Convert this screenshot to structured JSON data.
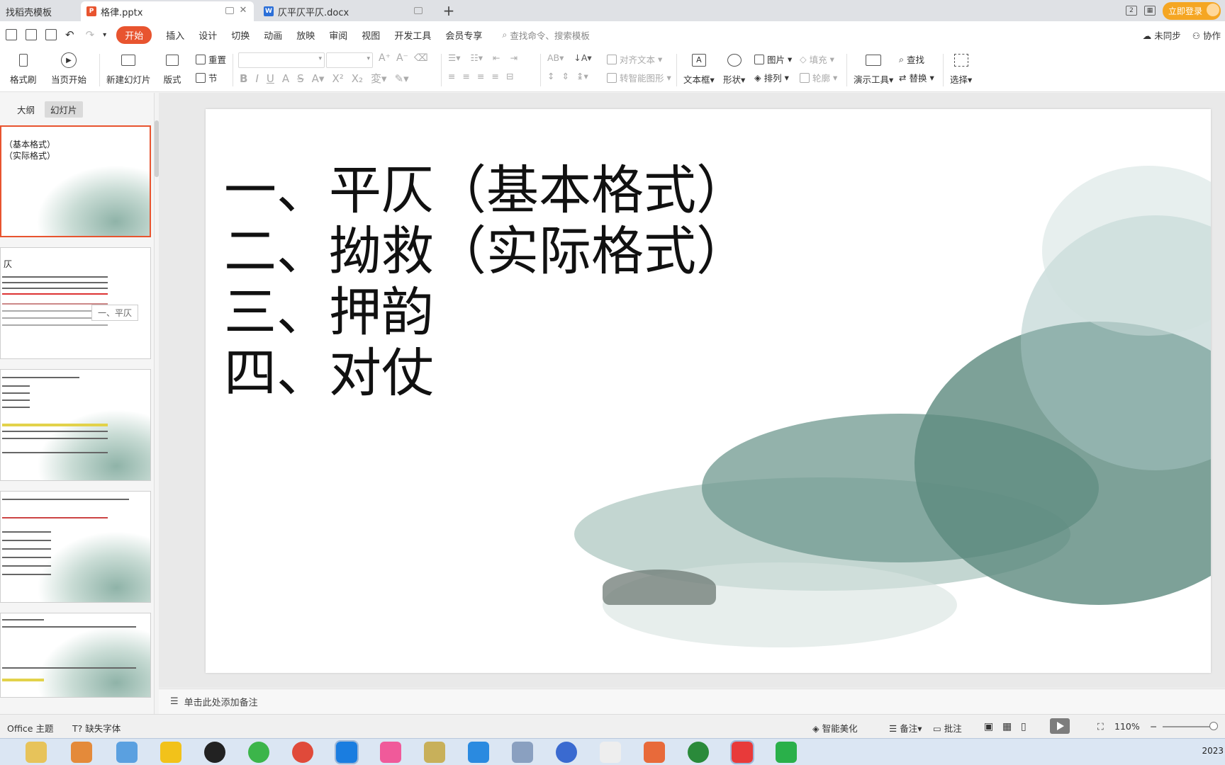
{
  "tabs": [
    {
      "label": "找稻壳模板",
      "icon": "docer-icon",
      "color": "#e8542f"
    },
    {
      "label": "格律.pptx",
      "icon": "ppt-icon",
      "color": "#e8542f"
    },
    {
      "label": "仄平仄平仄.docx",
      "icon": "word-icon",
      "color": "#2b6fd8"
    }
  ],
  "login_label": "立即登录",
  "menu": {
    "items": [
      "开始",
      "插入",
      "设计",
      "切换",
      "动画",
      "放映",
      "审阅",
      "视图",
      "开发工具",
      "会员专享"
    ],
    "search_placeholder": "查找命令、搜索模板",
    "right": [
      "未同步",
      "协作"
    ]
  },
  "ribbon": {
    "format_painter": "格式刷",
    "play_from_current": "当页开始",
    "new_slide": "新建幻灯片",
    "layout": "版式",
    "reset": "重置",
    "section": "节",
    "align_text": "对齐文本",
    "smart_shape": "转智能图形",
    "textbox": "文本框",
    "shape": "形状",
    "picture": "图片",
    "fill": "填充",
    "arrange": "排列",
    "outline": "轮廓",
    "presentation_tools": "演示工具",
    "find": "查找",
    "replace": "替换",
    "select": "选择"
  },
  "panel": {
    "tabs": [
      "大纲",
      "幻灯片"
    ],
    "thumb1_lines": [
      "（基本格式）",
      "（实际格式）"
    ],
    "thumb2_title": "仄",
    "thumb2_tooltip": "一、平仄"
  },
  "slide": {
    "lines": [
      "一、平仄（基本格式）",
      "二、拗救（实际格式）",
      "三、押韵",
      "四、对仗"
    ]
  },
  "notes_placeholder": "单击此处添加备注",
  "status": {
    "theme": "Office 主题",
    "missing_font": "缺失字体",
    "smart_beautify": "智能美化",
    "notes": "备注",
    "comments": "批注",
    "zoom": "110%"
  },
  "clock_year": "2023"
}
